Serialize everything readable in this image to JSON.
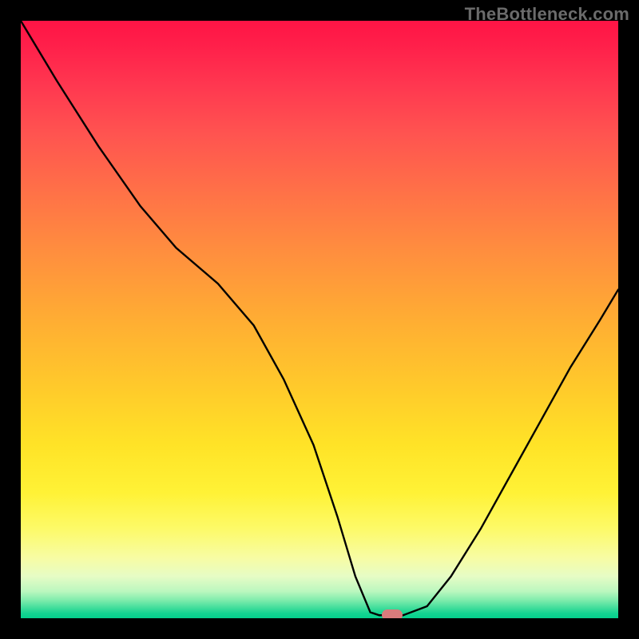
{
  "watermark": "TheBottleneck.com",
  "chart_data": {
    "type": "line",
    "title": "",
    "xlabel": "",
    "ylabel": "",
    "xlim": [
      0,
      1
    ],
    "ylim": [
      0,
      1
    ],
    "grid": false,
    "series": [
      {
        "name": "curve",
        "x": [
          0.0,
          0.06,
          0.13,
          0.2,
          0.26,
          0.33,
          0.39,
          0.44,
          0.49,
          0.53,
          0.56,
          0.585,
          0.6,
          0.64,
          0.68,
          0.72,
          0.77,
          0.82,
          0.87,
          0.92,
          0.97,
          1.0
        ],
        "values": [
          1.0,
          0.9,
          0.79,
          0.69,
          0.62,
          0.56,
          0.49,
          0.4,
          0.29,
          0.17,
          0.07,
          0.01,
          0.005,
          0.005,
          0.02,
          0.07,
          0.15,
          0.24,
          0.33,
          0.42,
          0.5,
          0.55
        ]
      }
    ],
    "marker": {
      "x": 0.621,
      "y": 0.005
    },
    "background_gradient_stops": [
      {
        "pos": 0.0,
        "color": "#ff1445"
      },
      {
        "pos": 0.5,
        "color": "#ffad33"
      },
      {
        "pos": 0.85,
        "color": "#fdfa68"
      },
      {
        "pos": 1.0,
        "color": "#05cf8c"
      }
    ]
  }
}
